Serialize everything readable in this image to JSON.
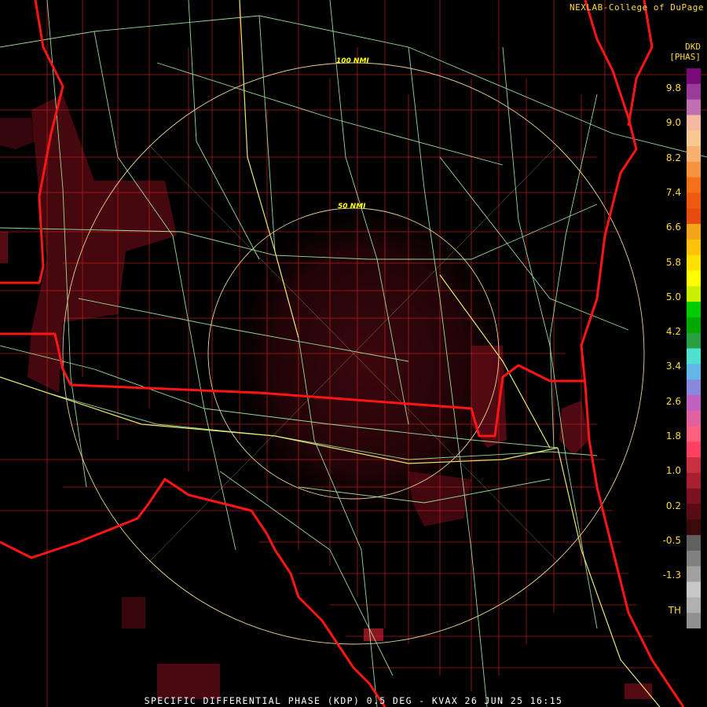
{
  "credit": "NEXLAB-College of DuPage",
  "footer": "SPECIFIC DIFFERENTIAL PHASE (KDP) 0.5 DEG - KVAX 26 JUN 25 16:15",
  "legend": {
    "unit_line1": "DKD",
    "unit_line2": "[PHAS]",
    "ticks": [
      "9.8",
      "9.0",
      "8.2",
      "7.4",
      "6.6",
      "5.8",
      "5.0",
      "4.2",
      "3.4",
      "2.6",
      "1.8",
      "1.0",
      "0.2",
      "-0.5",
      "-1.3",
      "TH"
    ],
    "colors": [
      "#7a0a7a",
      "#9a3a9a",
      "#c070b0",
      "#f6b8a0",
      "#f8c890",
      "#f8b070",
      "#f79240",
      "#f57018",
      "#ee5a10",
      "#e84a10",
      "#f3a418",
      "#ffc20a",
      "#ffe000",
      "#ffff00",
      "#c8f000",
      "#00cc00",
      "#00a800",
      "#28a040",
      "#50e0d0",
      "#60b8e8",
      "#8888dd",
      "#c060c0",
      "#e060a0",
      "#ff6080",
      "#ff4060",
      "#c83040",
      "#a82030",
      "#7a1020",
      "#5a0a14",
      "#3a0a0a",
      "#606060",
      "#808080",
      "#a0a0a0",
      "#c8c8c8",
      "#b0b0b0",
      "#909090"
    ]
  },
  "rings": {
    "inner_label": "50 NMI",
    "outer_label": "100 NMI"
  },
  "colors": {
    "state_border": "#ff1414",
    "county": "#cc1f1f",
    "highway": "#a8f0a8",
    "interstate": "#e8e870",
    "ring": "#e8d090"
  }
}
